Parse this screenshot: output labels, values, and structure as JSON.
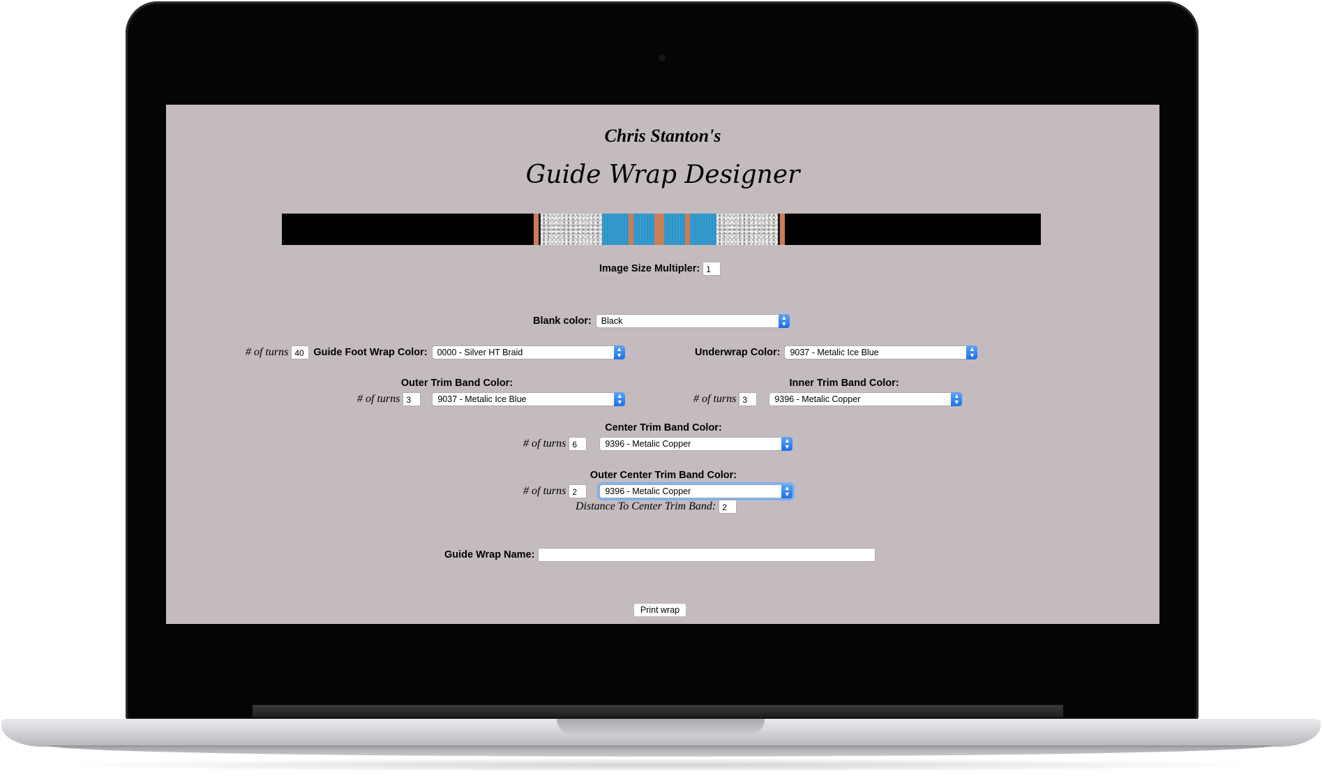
{
  "header": {
    "subtitle": "Chris Stanton's",
    "title": "Guide Wrap Designer"
  },
  "preview": {
    "colors": {
      "blank": "#000000",
      "foot_wrap": "#c8c8c8",
      "trim": "#c97e56",
      "underwrap": "#2b8cc0"
    }
  },
  "image_size": {
    "label": "Image Size Multipler:",
    "value": "1"
  },
  "blank_color": {
    "label": "Blank color:",
    "value": "Black"
  },
  "foot_wrap": {
    "turns_label": "# of turns",
    "turns": "40",
    "label": "Guide Foot Wrap Color:",
    "value": "0000 - Silver HT Braid"
  },
  "underwrap": {
    "label": "Underwrap Color:",
    "value": "9037 - Metalic Ice Blue"
  },
  "outer_trim": {
    "label": "Outer Trim Band Color:",
    "turns_label": "# of turns",
    "turns": "3",
    "value": "9037 - Metalic Ice Blue"
  },
  "inner_trim": {
    "label": "Inner Trim Band Color:",
    "turns_label": "# of turns",
    "turns": "3",
    "value": "9396 - Metalic Copper"
  },
  "center_trim": {
    "label": "Center Trim Band Color:",
    "turns_label": "# of turns",
    "turns": "6",
    "value": "9396 - Metalic Copper"
  },
  "outer_center_trim": {
    "label": "Outer Center Trim Band Color:",
    "turns_label": "# of turns",
    "turns": "2",
    "value": "9396 - Metalic Copper",
    "distance_label": "Distance To Center Trim Band:",
    "distance": "2"
  },
  "wrap_name": {
    "label": "Guide Wrap Name:",
    "value": ""
  },
  "print_button": {
    "label": "Print wrap"
  }
}
